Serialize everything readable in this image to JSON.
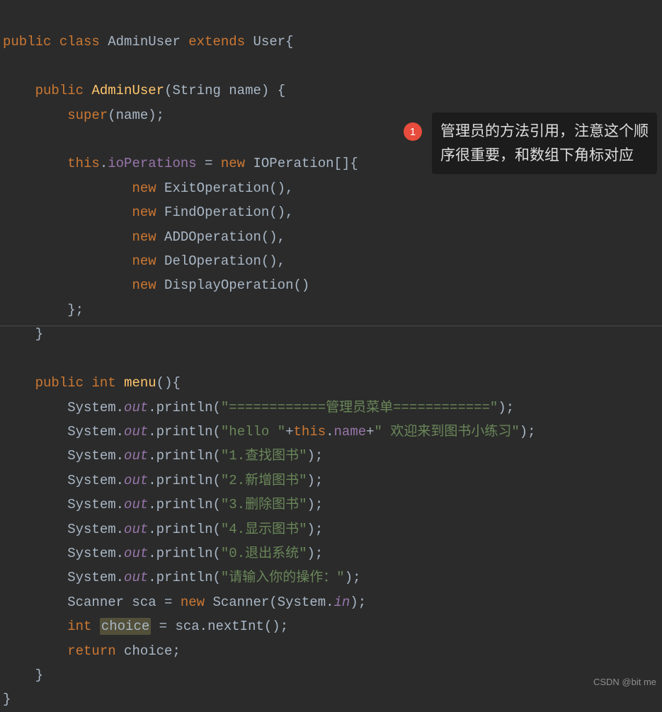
{
  "code": {
    "class_decl": {
      "public": "public",
      "class": "class",
      "name": "AdminUser",
      "extends": "extends",
      "super_name": "User",
      "brace": "{"
    },
    "ctor": {
      "public": "public",
      "name": "AdminUser",
      "sig_open": "(String name) {",
      "super_kw": "super",
      "super_rest": "(name);",
      "this_kw": "this",
      "dot": ".",
      "field": "ioPerations",
      "equals": " = ",
      "new_kw": "new",
      "type": " IOPeration[]{",
      "ops": [
        {
          "new": "new",
          "call": " ExitOperation(),"
        },
        {
          "new": "new",
          "call": " FindOperation(),"
        },
        {
          "new": "new",
          "call": " ADDOperation(),"
        },
        {
          "new": "new",
          "call": " DelOperation(),"
        },
        {
          "new": "new",
          "call": " DisplayOperation()"
        }
      ],
      "close_arr": "};",
      "close_ctor": "}"
    },
    "menu": {
      "public": "public",
      "int": "int",
      "name": "menu",
      "sig": "(){",
      "sys": "System.",
      "out": "out",
      "println": ".println(",
      "s1": "\"============管理员菜单============\"",
      "s2a": "\"hello \"",
      "plus1": "+",
      "this_kw": "this",
      "dot": ".",
      "name_field": "name",
      "plus2": "+",
      "s2b": "\" 欢迎来到图书小练习\"",
      "s3": "\"1.查找图书\"",
      "s4": "\"2.新增图书\"",
      "s5": "\"3.删除图书\"",
      "s6": "\"4.显示图书\"",
      "s7": "\"0.退出系统\"",
      "s8": "\"请输入你的操作：\"",
      "close_call": ");",
      "scanner_line_pre": "Scanner sca = ",
      "new_kw": "new",
      "scanner_ctor_pre": " Scanner(System.",
      "in": "in",
      "scanner_ctor_post": ");",
      "int_decl": "int",
      "choice": "choice",
      "assign": " = sca.nextInt();",
      "return_kw": "return",
      "return_rest": " choice;",
      "close": "}"
    },
    "class_close": "}"
  },
  "annotation": {
    "badge": "1",
    "tooltip": "管理员的方法引用，注意这个顺序很重要，和数组下角标对应"
  },
  "watermark": "CSDN @bit me"
}
